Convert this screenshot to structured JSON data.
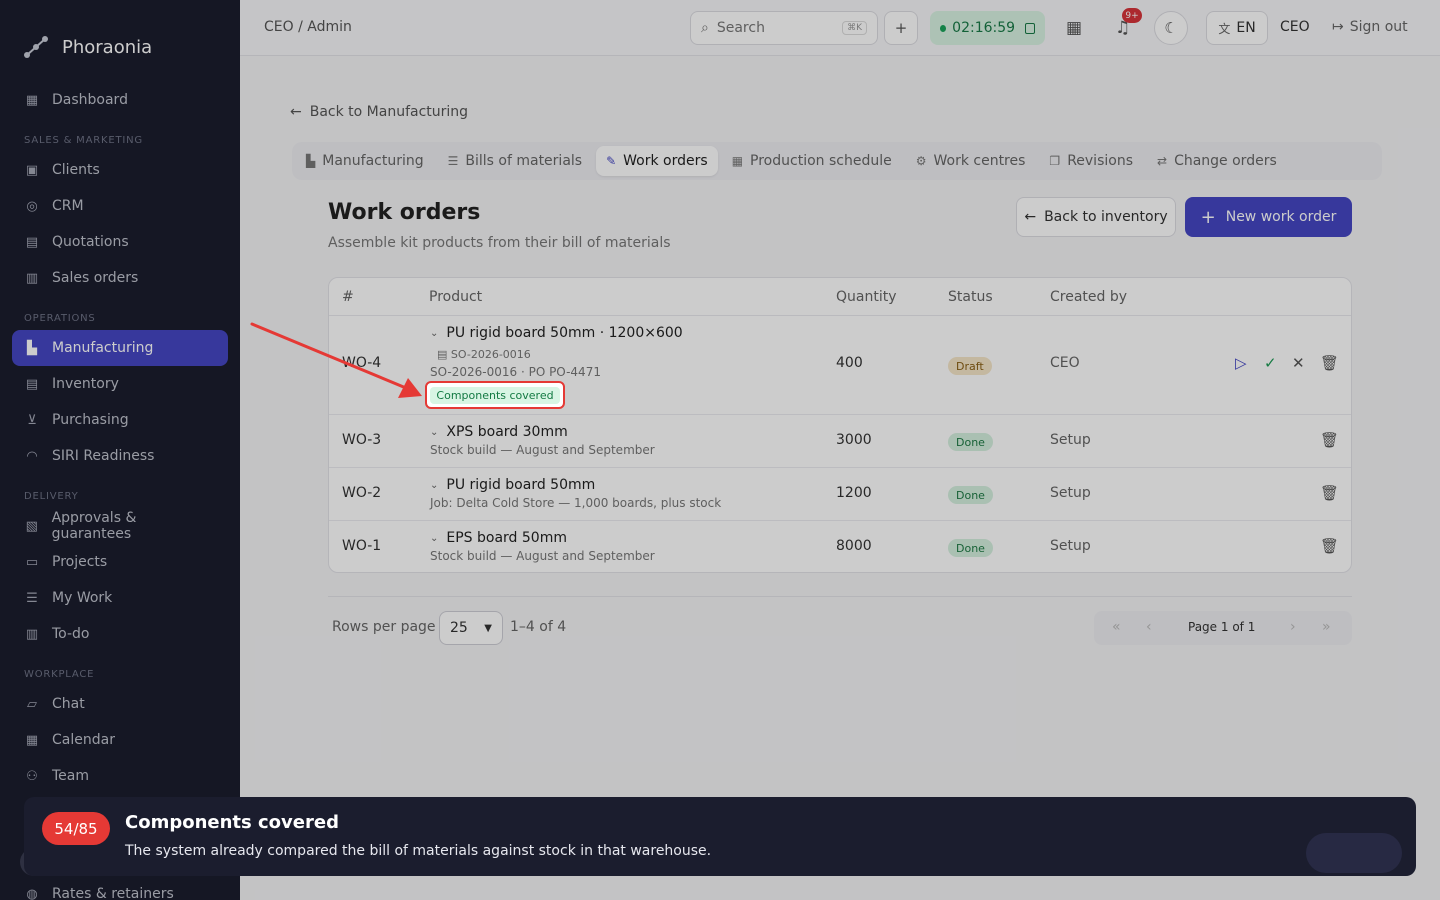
{
  "app": {
    "name": "Phoraonia"
  },
  "sidebar": {
    "top_item": {
      "label": "Dashboard",
      "icon": "dashboard-icon"
    },
    "sections": [
      {
        "title": "SALES & MARKETING",
        "items": [
          "Clients",
          "CRM",
          "Quotations",
          "Sales orders"
        ]
      },
      {
        "title": "OPERATIONS",
        "items": [
          "Manufacturing",
          "Inventory",
          "Purchasing",
          "SIRI Readiness"
        ]
      },
      {
        "title": "DELIVERY",
        "items": [
          "Approvals & guarantees",
          "Projects",
          "My Work",
          "To-do"
        ]
      },
      {
        "title": "WORKPLACE",
        "items": [
          "Chat",
          "Calendar",
          "Team"
        ]
      }
    ],
    "bottom_item": "Rates & retainers",
    "active": "Manufacturing"
  },
  "header": {
    "breadcrumb": "CEO / Admin",
    "search_placeholder": "Search",
    "search_shortcut": "⌘K",
    "timer": "02:16:59",
    "notification_count": "9+",
    "language": "EN",
    "user_role": "CEO",
    "sign_out": "Sign out"
  },
  "main": {
    "back_link": "Back to Manufacturing",
    "tabs": [
      "Manufacturing",
      "Bills of materials",
      "Work orders",
      "Production schedule",
      "Work centres",
      "Revisions",
      "Change orders"
    ],
    "active_tab": "Work orders",
    "title": "Work orders",
    "subtitle": "Assemble kit products from their bill of materials",
    "back_inventory_button": "Back to inventory",
    "new_work_order_button": "New work order"
  },
  "table": {
    "columns": [
      "#",
      "Product",
      "Quantity",
      "Status",
      "Created by"
    ],
    "rows": [
      {
        "id": "WO-4",
        "product": "PU rigid board 50mm · 1200×600",
        "ref": "SO-2026-0016",
        "detail": "SO-2026-0016 · PO PO-4471",
        "quantity": "400",
        "status": "Draft",
        "created_by": "CEO",
        "tag": "Components covered"
      },
      {
        "id": "WO-3",
        "product": "XPS board 30mm",
        "detail": "Stock build — August and September",
        "quantity": "3000",
        "status": "Done",
        "created_by": "Setup"
      },
      {
        "id": "WO-2",
        "product": "PU rigid board 50mm",
        "detail": "Job: Delta Cold Store — 1,000 boards, plus stock",
        "quantity": "1200",
        "status": "Done",
        "created_by": "Setup"
      },
      {
        "id": "WO-1",
        "product": "EPS board 50mm",
        "detail": "Stock build — August and September",
        "quantity": "8000",
        "status": "Done",
        "created_by": "Setup"
      }
    ]
  },
  "pagination": {
    "rows_per_page_label": "Rows per page",
    "rows_per_page": "25",
    "range": "1–4 of 4",
    "page_label": "Page 1 of 1"
  },
  "tour": {
    "step": "54/85",
    "title": "Components covered",
    "text": "The system already compared the bill of materials against stock in that warehouse."
  },
  "colors": {
    "accent": "#4547c4",
    "sidebar": "#1b1d2e",
    "highlight": "#e53935",
    "done": "#1d7a44",
    "draft": "#8a6014"
  }
}
